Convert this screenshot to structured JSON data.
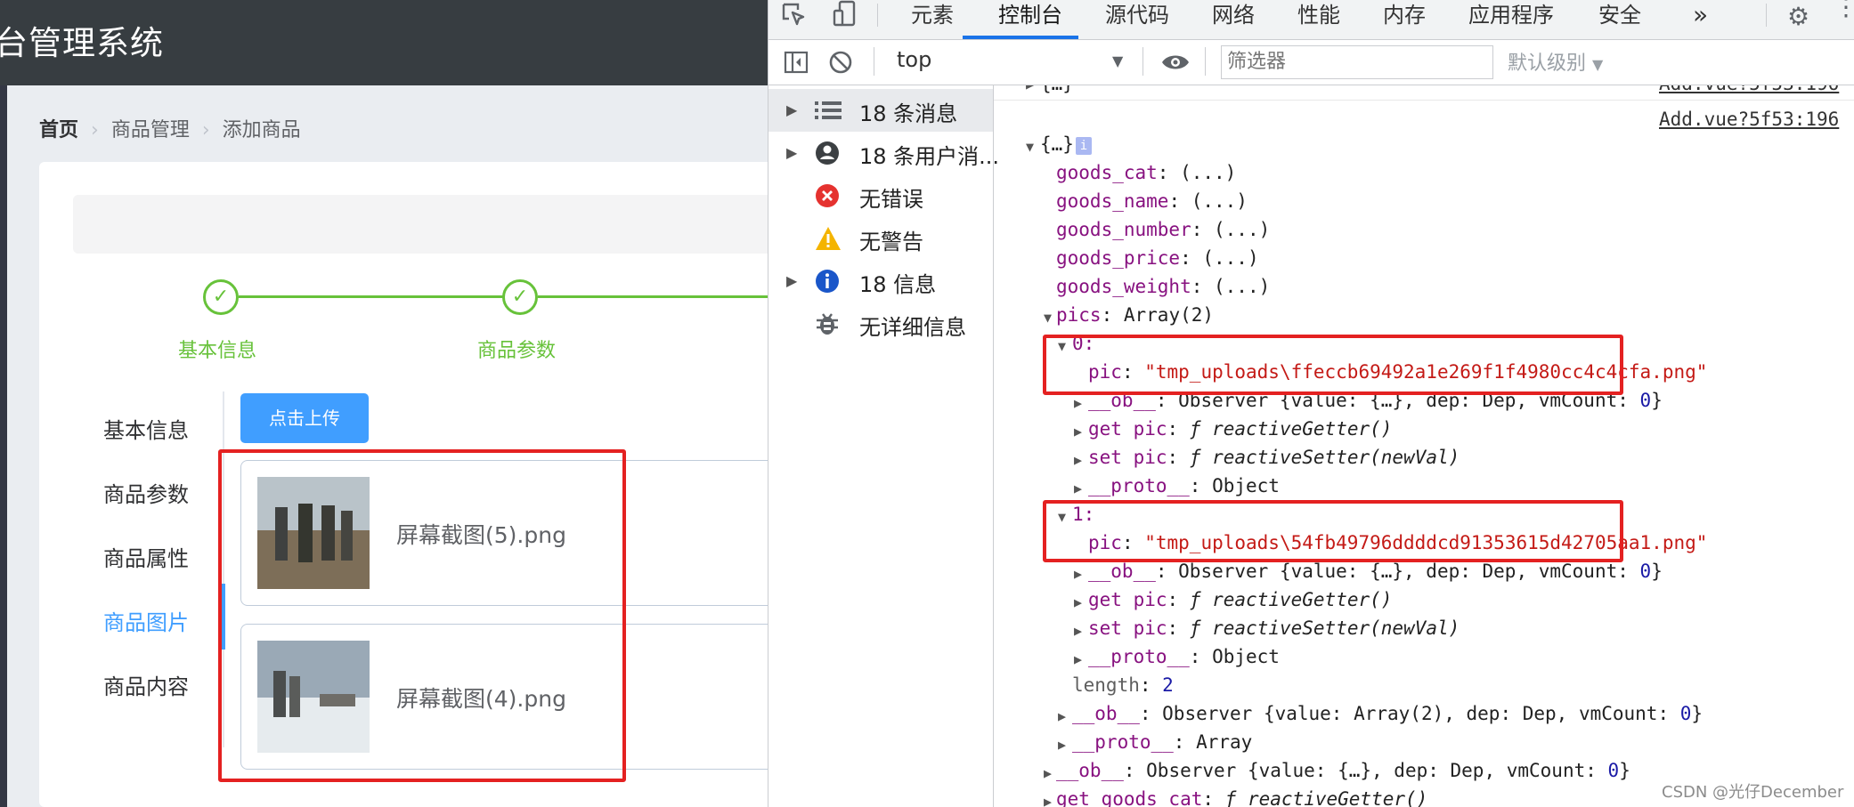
{
  "app": {
    "title": "台管理系统",
    "breadcrumb": {
      "home": "首页",
      "level2": "商品管理",
      "level3": "添加商品",
      "separator": "›"
    },
    "steps": [
      {
        "title": "基本信息",
        "status": "finished"
      },
      {
        "title": "商品参数",
        "status": "finished"
      }
    ],
    "tabs": [
      {
        "label": "基本信息"
      },
      {
        "label": "商品参数"
      },
      {
        "label": "商品属性"
      },
      {
        "label": "商品图片",
        "active": true
      },
      {
        "label": "商品内容"
      }
    ],
    "upload_button": "点击上传",
    "files": [
      {
        "name": "屏幕截图(5).png"
      },
      {
        "name": "屏幕截图(4).png"
      }
    ]
  },
  "devtools": {
    "tabs": [
      "元素",
      "控制台",
      "源代码",
      "网络",
      "性能",
      "内存",
      "应用程序",
      "安全"
    ],
    "active_tab": "控制台",
    "more_tabs": "»",
    "context": "top",
    "filter_placeholder": "筛选器",
    "level": "默认级别",
    "sidebar": [
      {
        "label": "18 条消息",
        "icon": "list-icon",
        "expandable": true,
        "selected": true
      },
      {
        "label": "18 条用户消...",
        "icon": "user-icon",
        "expandable": true
      },
      {
        "label": "无错误",
        "icon": "error-icon",
        "expandable": false
      },
      {
        "label": "无警告",
        "icon": "warning-icon",
        "expandable": false
      },
      {
        "label": "18 信息",
        "icon": "info-icon",
        "expandable": true
      },
      {
        "label": "无详细信息",
        "icon": "bug-icon",
        "expandable": false
      }
    ],
    "console": {
      "top_cut_text": "{…}",
      "top_cut_source": "Add.vue?5f53:196",
      "source": "Add.vue?5f53:196",
      "object_label": "{…}",
      "info_badge": "i",
      "props": [
        {
          "key": "goods_cat",
          "value": "(...)"
        },
        {
          "key": "goods_name",
          "value": "(...)"
        },
        {
          "key": "goods_number",
          "value": "(...)"
        },
        {
          "key": "goods_price",
          "value": "(...)"
        },
        {
          "key": "goods_weight",
          "value": "(...)"
        }
      ],
      "pics_key": "pics",
      "pics_value": "Array(2)",
      "pics": [
        {
          "index": "0:",
          "pic_key": "pic",
          "pic_value": "\"tmp_uploads\\ffeccb69492a1e269f1f4980cc4c4cfa.png\""
        },
        {
          "index": "1:",
          "pic_key": "pic",
          "pic_value": "\"tmp_uploads\\54fb49796ddddcd91353615d42705aa1.png\""
        }
      ],
      "ob_key": "__ob__",
      "ob_value": "Observer {value: {…}, dep: Dep, vmCount: ",
      "ob_count": "0",
      "ob_close": "}",
      "get_pic": "get pic",
      "set_pic": "set pic",
      "getter": "reactiveGetter()",
      "setter": "reactiveSetter(newVal)",
      "f_symbol": "ƒ",
      "proto_key": "__proto__",
      "proto_object": "Object",
      "length_key": "length",
      "length_value": "2",
      "arr_ob_value": "Observer {value: Array(2), dep: Dep, vmCount: ",
      "proto_array": "Array",
      "outer_ob_value": "Observer {value: {…}, dep: Dep, vmCount: ",
      "get_goods_cat": "get goods_cat"
    }
  },
  "watermark": "CSDN @光仔December",
  "colors": {
    "accent": "#409eff",
    "success": "#67c23a",
    "highlight": "#e42121",
    "header": "#373d41"
  }
}
